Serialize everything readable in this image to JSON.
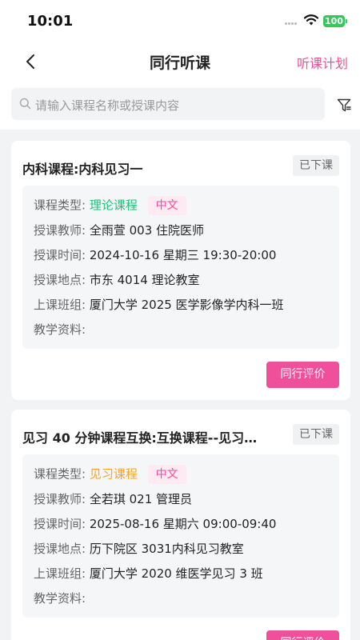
{
  "status_bar": {
    "time": "10:01",
    "battery": "100"
  },
  "nav": {
    "title": "同行听课",
    "action": "听课计划"
  },
  "search": {
    "placeholder": "请输入课程名称或授课内容"
  },
  "labels": {
    "type": "课程类型:",
    "teacher": "授课教师:",
    "time": "授课时间:",
    "location": "授课地点:",
    "class": "上课班组:",
    "materials": "教学资料:"
  },
  "courses": [
    {
      "title": "内科课程:内科见习一",
      "status": "已下课",
      "type": "理论课程",
      "language": "中文",
      "teacher": "全雨萱 003 住院医师",
      "time": "2024-10-16 星期三 19:30-20:00",
      "location": "市东 4014 理论教室",
      "class": "厦门大学 2025 医学影像学内科一班",
      "materials": "",
      "action": "同行评价"
    },
    {
      "title": "见习 40 分钟课程互换:互换课程--见习…",
      "status": "已下课",
      "type": "见习课程",
      "language": "中文",
      "teacher": "全若琪 021 管理员",
      "time": "2025-08-16 星期六 09:00-09:40",
      "location": "历下院区 3031内科见习教室",
      "class": "厦门大学 2020 维医学见习 3 班",
      "materials": "",
      "action": "同行评价"
    }
  ],
  "colors": {
    "accent": "#f0509a",
    "theory": "#1ec27a",
    "practice": "#f5a623",
    "battery": "#34c759"
  }
}
